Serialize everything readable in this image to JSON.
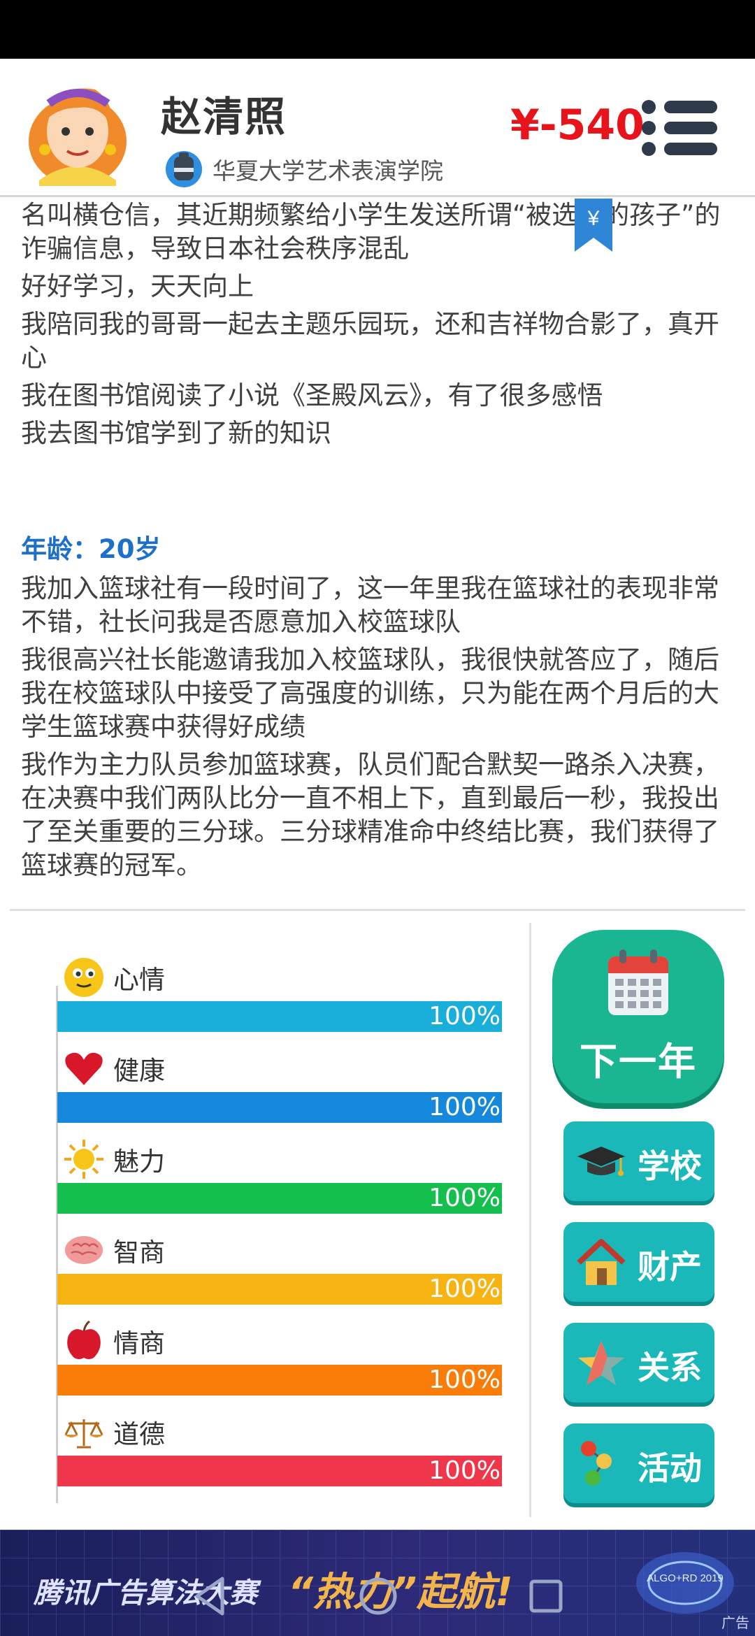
{
  "header": {
    "name": "赵清照",
    "school": "华夏大学艺术表演学院",
    "money": "¥-540",
    "bookmark_symbol": "¥"
  },
  "story": {
    "paragraphs_before": [
      "名叫横仓信，其近期频繁给小学生发送所谓“被选召的孩子”的诈骗信息，导致日本社会秩序混乱",
      "好好学习，天天向上",
      "我陪同我的哥哥一起去主题乐园玩，还和吉祥物合影了，真开心",
      "我在图书馆阅读了小说《圣殿风云》，有了很多感悟",
      "我去图书馆学到了新的知识"
    ],
    "age_label": "年龄：20岁",
    "paragraphs_after": [
      "我加入篮球社有一段时间了，这一年里我在篮球社的表现非常不错，社长问我是否愿意加入校篮球队",
      "我很高兴社长能邀请我加入校篮球队，我很快就答应了，随后我在校篮球队中接受了高强度的训练，只为能在两个月后的大学生篮球赛中获得好成绩",
      "我作为主力队员参加篮球赛，队员们配合默契一路杀入决赛，在决赛中我们两队比分一直不相上下，直到最后一秒，我投出了至关重要的三分球。三分球精准命中终结比赛，我们获得了篮球赛的冠军。"
    ]
  },
  "stats": [
    {
      "label": "心情",
      "value": "100%",
      "fill": 1.0,
      "color": "#1aaedb",
      "icon": "smiley-icon"
    },
    {
      "label": "健康",
      "value": "100%",
      "fill": 1.0,
      "color": "#1588db",
      "icon": "heart-icon"
    },
    {
      "label": "魅力",
      "value": "100%",
      "fill": 1.0,
      "color": "#14bf4e",
      "icon": "sun-icon"
    },
    {
      "label": "智商",
      "value": "100%",
      "fill": 1.0,
      "color": "#f6b312",
      "icon": "brain-icon"
    },
    {
      "label": "情商",
      "value": "100%",
      "fill": 1.0,
      "color": "#fa7d0a",
      "icon": "apple-icon"
    },
    {
      "label": "道德",
      "value": "100%",
      "fill": 1.0,
      "color": "#f0364a",
      "icon": "scales-icon"
    }
  ],
  "actions": {
    "next_year": "下一年",
    "school": "学校",
    "property": "财产",
    "relations": "关系",
    "activity": "活动"
  },
  "ad": {
    "text1": "腾讯广告算法大赛",
    "text2": "“热力”起航!",
    "badge": "ALGO+RD 2019",
    "corner": "广告"
  }
}
